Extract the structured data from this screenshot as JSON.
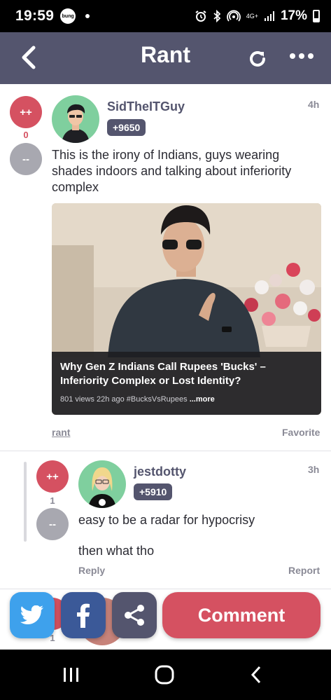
{
  "status_bar": {
    "time": "19:59",
    "notification_app": "bung",
    "network": "4G+",
    "battery_pct": "17%"
  },
  "app_bar": {
    "title": "Rant"
  },
  "post": {
    "vote_up_label": "++",
    "vote_down_label": "--",
    "score": "0",
    "username": "SidTheITGuy",
    "reputation": "+9650",
    "time_ago": "4h",
    "text": "This is the irony of Indians, guys wearing shades indoors and talking about inferiority complex",
    "video": {
      "title": "Why Gen Z Indians Call Rupees 'Bucks' – Inferiority Complex or Lost Identity?",
      "meta": "801 views  22h ago  #BucksVsRupees",
      "more_label": "...more"
    },
    "tag_link": "rant",
    "favorite_label": "Favorite"
  },
  "comment": {
    "vote_up_label": "++",
    "vote_down_label": "--",
    "score": "1",
    "username": "jestdotty",
    "reputation": "+5910",
    "time_ago": "3h",
    "text_line1": "easy to be a radar for hypocrisy",
    "text_line2": "then what tho",
    "reply_label": "Reply",
    "report_label": "Report"
  },
  "next_comment": {
    "score": "1"
  },
  "action_bar": {
    "comment_label": "Comment"
  },
  "colors": {
    "header": "#54556e",
    "accent_red": "#d55161",
    "twitter": "#3ea1ec",
    "facebook": "#3b5998"
  }
}
